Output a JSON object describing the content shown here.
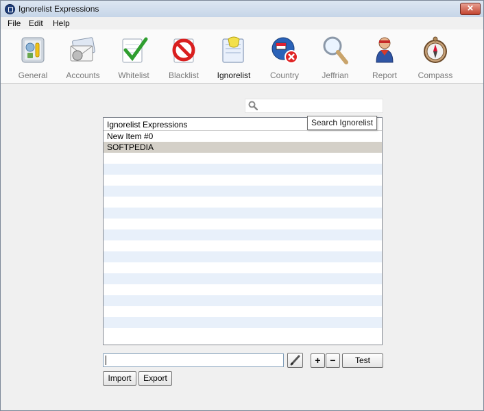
{
  "window": {
    "title": "Ignorelist Expressions",
    "close_label": "✕"
  },
  "menu": [
    "File",
    "Edit",
    "Help"
  ],
  "toolbar": [
    {
      "label": "General",
      "icon": "general-icon"
    },
    {
      "label": "Accounts",
      "icon": "accounts-icon"
    },
    {
      "label": "Whitelist",
      "icon": "whitelist-icon"
    },
    {
      "label": "Blacklist",
      "icon": "blacklist-icon"
    },
    {
      "label": "Ignorelist",
      "icon": "ignorelist-icon",
      "active": true
    },
    {
      "label": "Country",
      "icon": "country-icon"
    },
    {
      "label": "Jeffrian",
      "icon": "jeffrian-icon"
    },
    {
      "label": "Report",
      "icon": "report-icon"
    },
    {
      "label": "Compass",
      "icon": "compass-icon"
    }
  ],
  "search": {
    "value": "",
    "placeholder": "",
    "tooltip": "Search Ignorelist"
  },
  "list": {
    "header": "Ignorelist Expressions",
    "items": [
      "New Item #0",
      "SOFTPEDIA"
    ],
    "selected": "SOFTPEDIA"
  },
  "editor": {
    "value": ""
  },
  "buttons": {
    "plus": "+",
    "minus": "−",
    "test": "Test",
    "import": "Import",
    "export": "Export"
  }
}
